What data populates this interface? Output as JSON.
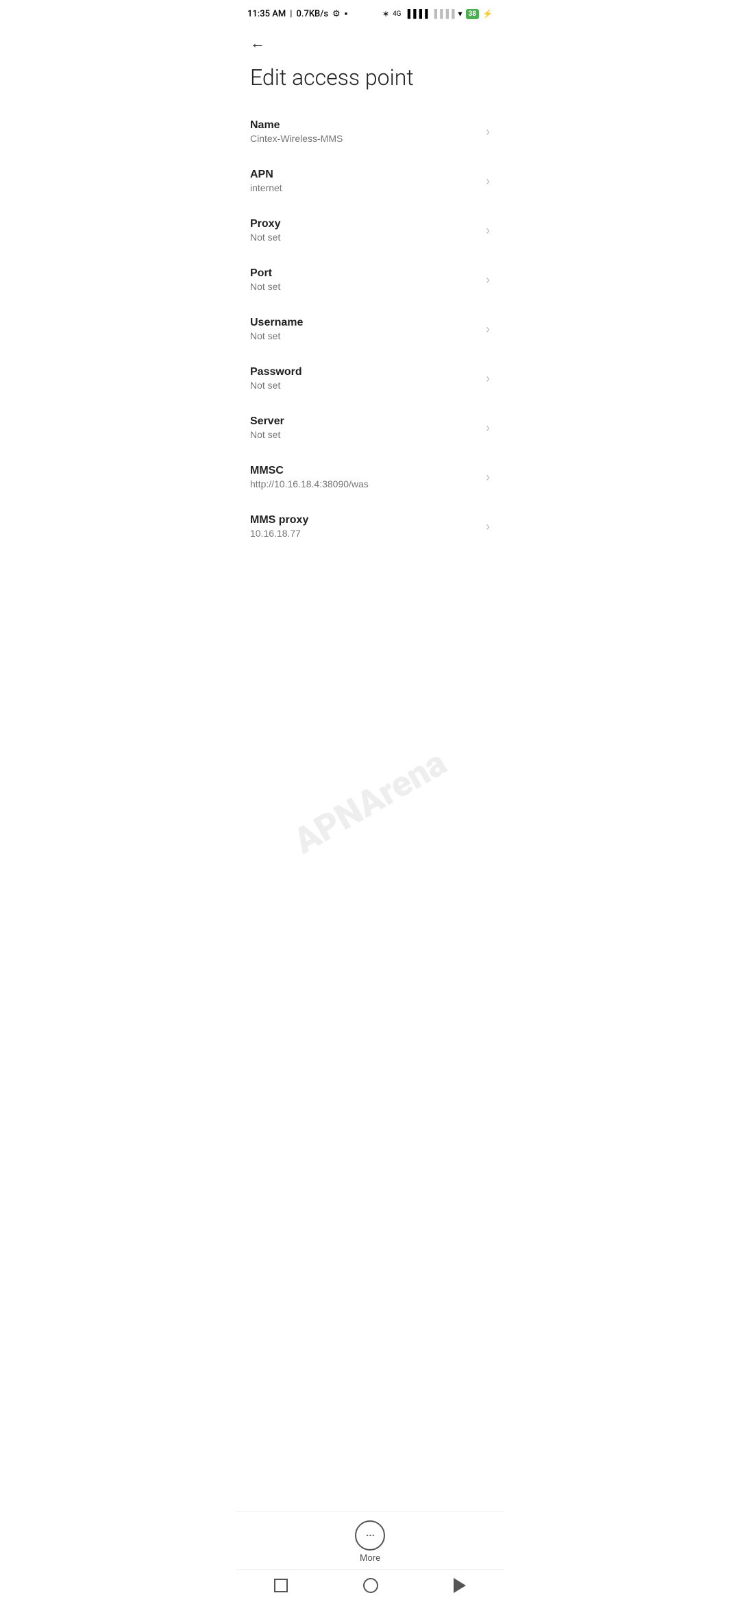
{
  "statusBar": {
    "time": "11:35 AM",
    "network": "0.7KB/s",
    "battery": "38"
  },
  "toolbar": {
    "backLabel": "←"
  },
  "page": {
    "title": "Edit access point"
  },
  "settings": [
    {
      "label": "Name",
      "value": "Cintex-Wireless-MMS"
    },
    {
      "label": "APN",
      "value": "internet"
    },
    {
      "label": "Proxy",
      "value": "Not set"
    },
    {
      "label": "Port",
      "value": "Not set"
    },
    {
      "label": "Username",
      "value": "Not set"
    },
    {
      "label": "Password",
      "value": "Not set"
    },
    {
      "label": "Server",
      "value": "Not set"
    },
    {
      "label": "MMSC",
      "value": "http://10.16.18.4:38090/was"
    },
    {
      "label": "MMS proxy",
      "value": "10.16.18.77"
    }
  ],
  "bottomMenu": {
    "moreLabel": "More"
  },
  "watermark": "APNArena"
}
